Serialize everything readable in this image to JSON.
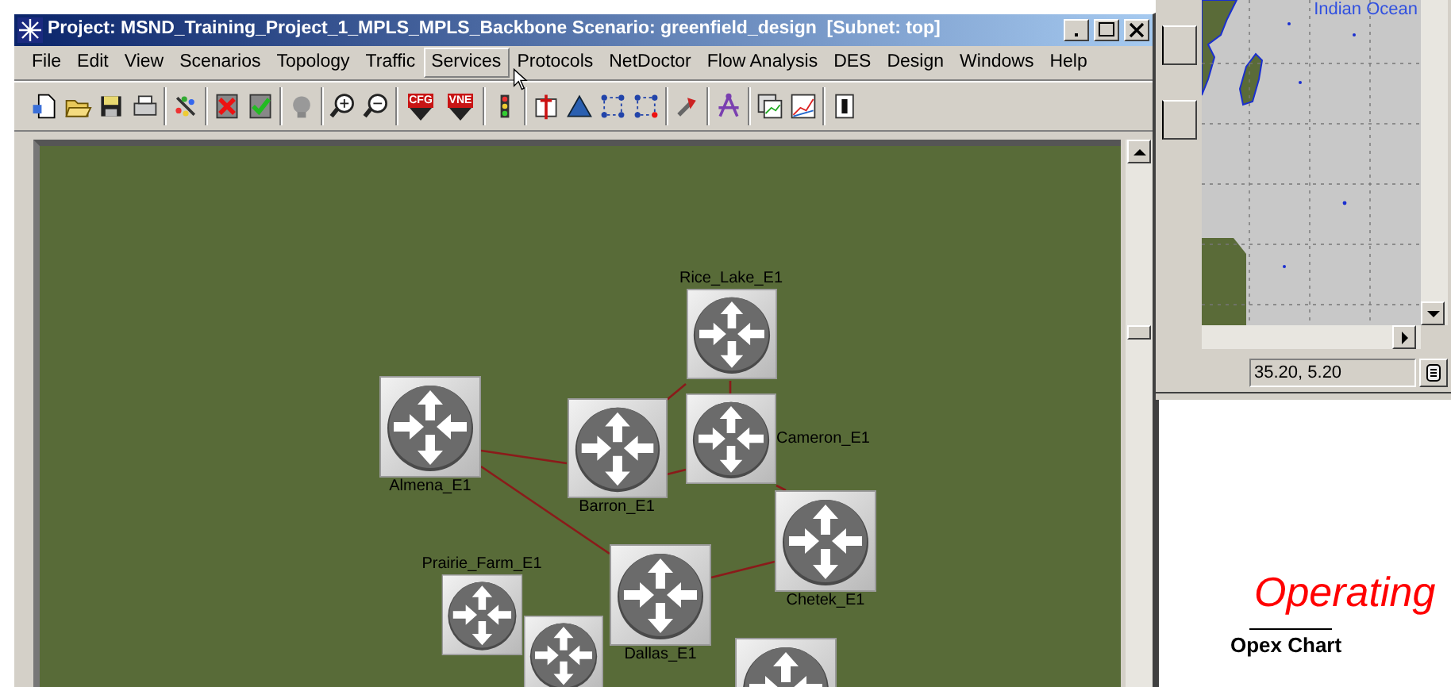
{
  "window": {
    "title": "Project: MSND_Training_Project_1_MPLS_MPLS_Backbone Scenario: greenfield_design  [Subnet: top]"
  },
  "menu": [
    {
      "label": "File",
      "selected": false
    },
    {
      "label": "Edit",
      "selected": false
    },
    {
      "label": "View",
      "selected": false
    },
    {
      "label": "Scenarios",
      "selected": false
    },
    {
      "label": "Topology",
      "selected": false
    },
    {
      "label": "Traffic",
      "selected": false
    },
    {
      "label": "Services",
      "selected": true
    },
    {
      "label": "Protocols",
      "selected": false
    },
    {
      "label": "NetDoctor",
      "selected": false
    },
    {
      "label": "Flow Analysis",
      "selected": false
    },
    {
      "label": "DES",
      "selected": false
    },
    {
      "label": "Design",
      "selected": false
    },
    {
      "label": "Windows",
      "selected": false
    },
    {
      "label": "Help",
      "selected": false
    }
  ],
  "toolbar": [
    {
      "kind": "new"
    },
    {
      "kind": "open"
    },
    {
      "kind": "save"
    },
    {
      "kind": "print"
    },
    {
      "kind": "separator"
    },
    {
      "kind": "colors"
    },
    {
      "kind": "separator"
    },
    {
      "kind": "fail"
    },
    {
      "kind": "recover"
    },
    {
      "kind": "separator"
    },
    {
      "kind": "bulb"
    },
    {
      "kind": "separator"
    },
    {
      "kind": "zoom-in"
    },
    {
      "kind": "zoom-out"
    },
    {
      "kind": "separator"
    },
    {
      "kind": "badge",
      "label": "CFG"
    },
    {
      "kind": "badge",
      "label": "VNE"
    },
    {
      "kind": "separator"
    },
    {
      "kind": "traffic-light"
    },
    {
      "kind": "separator"
    },
    {
      "kind": "tower"
    },
    {
      "kind": "triangle"
    },
    {
      "kind": "nodes"
    },
    {
      "kind": "nodes-x"
    },
    {
      "kind": "separator"
    },
    {
      "kind": "pin"
    },
    {
      "kind": "separator"
    },
    {
      "kind": "compass"
    },
    {
      "kind": "separator"
    },
    {
      "kind": "graphs"
    },
    {
      "kind": "chart"
    },
    {
      "kind": "separator"
    },
    {
      "kind": "panel"
    }
  ],
  "nodes": [
    {
      "kind": "router",
      "name": "Rice_Lake_E1"
    },
    {
      "kind": "router",
      "name": "Almena_E1"
    },
    {
      "kind": "router",
      "name": "Barron_E1"
    },
    {
      "kind": "router",
      "name": "Cameron_E1"
    },
    {
      "kind": "router",
      "name": "Chetek_E1"
    },
    {
      "kind": "router",
      "name": "Prairie_Farm_E1"
    },
    {
      "kind": "router"
    },
    {
      "kind": "router",
      "name": "Dallas_E1"
    },
    {
      "kind": "router"
    }
  ],
  "map_window": {
    "map_label": "Indian Ocean",
    "coordinates": "35.20, 5.20"
  },
  "document": {
    "heading": "Operating",
    "caption": "Opex Chart"
  }
}
